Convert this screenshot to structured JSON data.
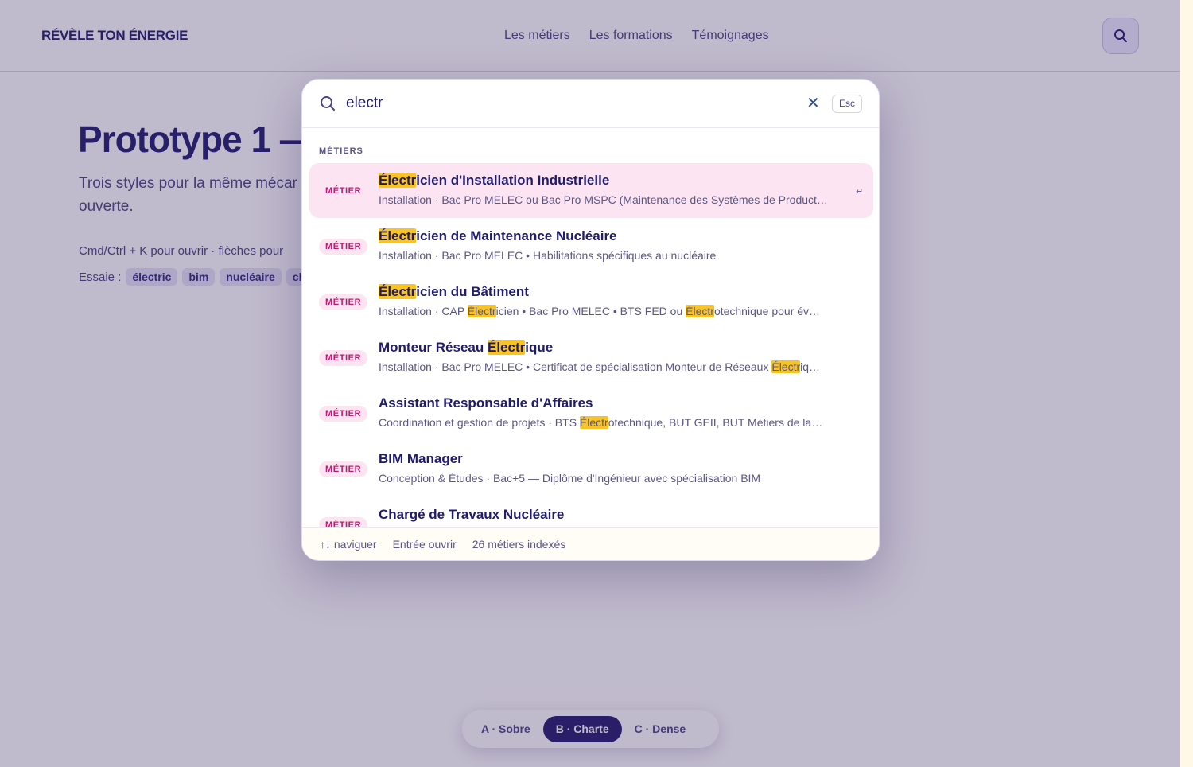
{
  "header": {
    "logo": "RÉVÈLE TON ÉNERGIE",
    "nav": [
      "Les métiers",
      "Les formations",
      "Témoignages"
    ],
    "search_icon": "search-icon"
  },
  "hero": {
    "title": "Prototype 1 —",
    "subtitle": "Trois styles pour la même mécar ouverte.",
    "hint": "Cmd/Ctrl + K pour ouvrir · flèches pour",
    "try_label": "Essaie :",
    "chips": [
      "électric",
      "bim",
      "nucléaire",
      "ch"
    ]
  },
  "search": {
    "value": "electr",
    "clear_icon": "close-icon",
    "esc_label": "Esc",
    "section_label": "MÉTIERS",
    "results": [
      {
        "badge": "MÉTIER",
        "title_parts": [
          {
            "t": "Électr",
            "h": true
          },
          {
            "t": "icien d'Installation Industrielle",
            "h": false
          }
        ],
        "sub_parts": [
          {
            "t": "Installation · Bac Pro MELEC ou Bac Pro MSPC (Maintenance des Systèmes de Product…",
            "h": false
          }
        ],
        "active": true
      },
      {
        "badge": "MÉTIER",
        "title_parts": [
          {
            "t": "Électr",
            "h": true
          },
          {
            "t": "icien de Maintenance Nucléaire",
            "h": false
          }
        ],
        "sub_parts": [
          {
            "t": "Installation · Bac Pro MELEC • Habilitations spécifiques au nucléaire",
            "h": false
          }
        ],
        "active": false
      },
      {
        "badge": "MÉTIER",
        "title_parts": [
          {
            "t": "Électr",
            "h": true
          },
          {
            "t": "icien du Bâtiment",
            "h": false
          }
        ],
        "sub_parts": [
          {
            "t": "Installation · CAP ",
            "h": false
          },
          {
            "t": "Électr",
            "h": true
          },
          {
            "t": "icien • Bac Pro MELEC • BTS FED ou ",
            "h": false
          },
          {
            "t": "Électr",
            "h": true
          },
          {
            "t": "otechnique pour év…",
            "h": false
          }
        ],
        "active": false
      },
      {
        "badge": "MÉTIER",
        "title_parts": [
          {
            "t": "Monteur Réseau ",
            "h": false
          },
          {
            "t": "Électr",
            "h": true
          },
          {
            "t": "ique",
            "h": false
          }
        ],
        "sub_parts": [
          {
            "t": "Installation · Bac Pro MELEC • Certificat de spécialisation Monteur de Réseaux ",
            "h": false
          },
          {
            "t": "Électr",
            "h": true
          },
          {
            "t": "iq…",
            "h": false
          }
        ],
        "active": false
      },
      {
        "badge": "MÉTIER",
        "title_parts": [
          {
            "t": "Assistant Responsable d'Affaires",
            "h": false
          }
        ],
        "sub_parts": [
          {
            "t": "Coordination et gestion de projets · BTS ",
            "h": false
          },
          {
            "t": "Électr",
            "h": true
          },
          {
            "t": "otechnique, BUT GEII, BUT Métiers de la…",
            "h": false
          }
        ],
        "active": false
      },
      {
        "badge": "MÉTIER",
        "title_parts": [
          {
            "t": "BIM Manager",
            "h": false
          }
        ],
        "sub_parts": [
          {
            "t": "Conception & Études · Bac+5 — Diplôme d'Ingénieur avec spécialisation BIM",
            "h": false
          }
        ],
        "active": false
      },
      {
        "badge": "MÉTIER",
        "title_parts": [
          {
            "t": "Chargé de Travaux Nucléaire",
            "h": false
          }
        ],
        "sub_parts": [],
        "active": false
      }
    ],
    "footer": [
      "↑↓ naviguer",
      "Entrée ouvrir",
      "26 métiers indexés"
    ]
  },
  "style_toggle": {
    "options": [
      "A · Sobre",
      "B · Charte",
      "C · Dense"
    ],
    "selected": "B · Charte"
  }
}
